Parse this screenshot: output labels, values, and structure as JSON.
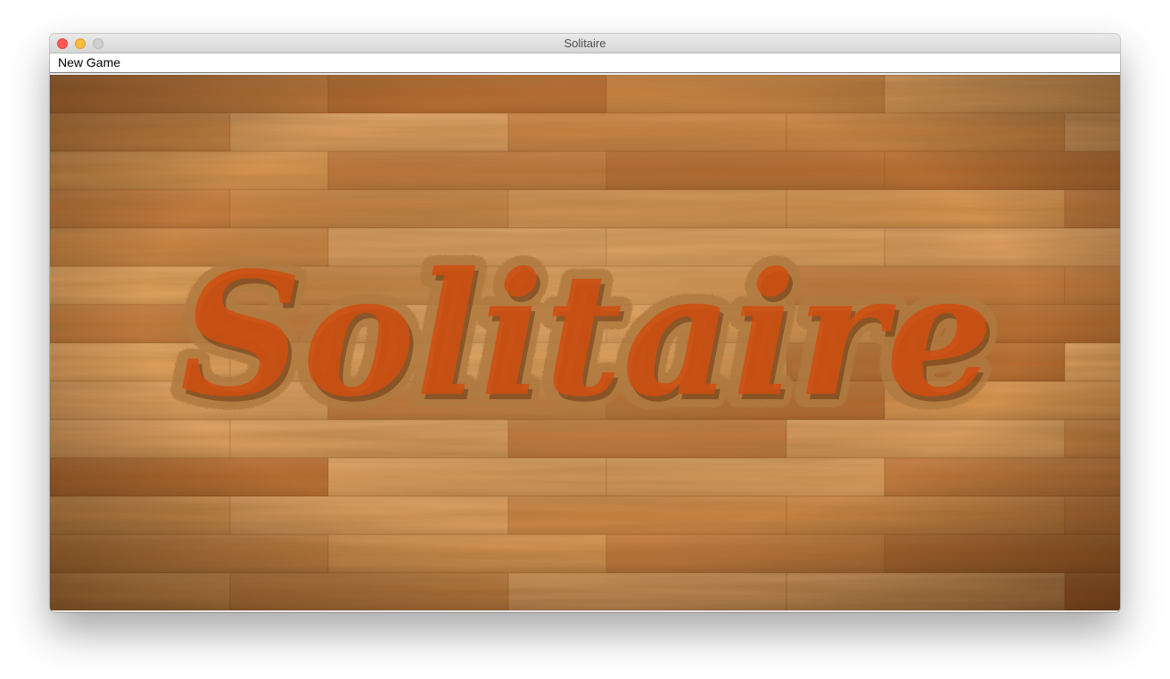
{
  "window": {
    "title": "Solitaire",
    "controls": [
      "close",
      "minimize",
      "zoom"
    ]
  },
  "menubar": {
    "items": [
      {
        "label": "New Game"
      }
    ]
  },
  "table": {
    "splash_title": "Solitaire",
    "background": "wood-parquet",
    "colors": {
      "wood_light": "#e9a65f",
      "wood_mid": "#cf8542",
      "wood_dark": "#8a4a18",
      "title_fill": "#cf4f12"
    }
  }
}
